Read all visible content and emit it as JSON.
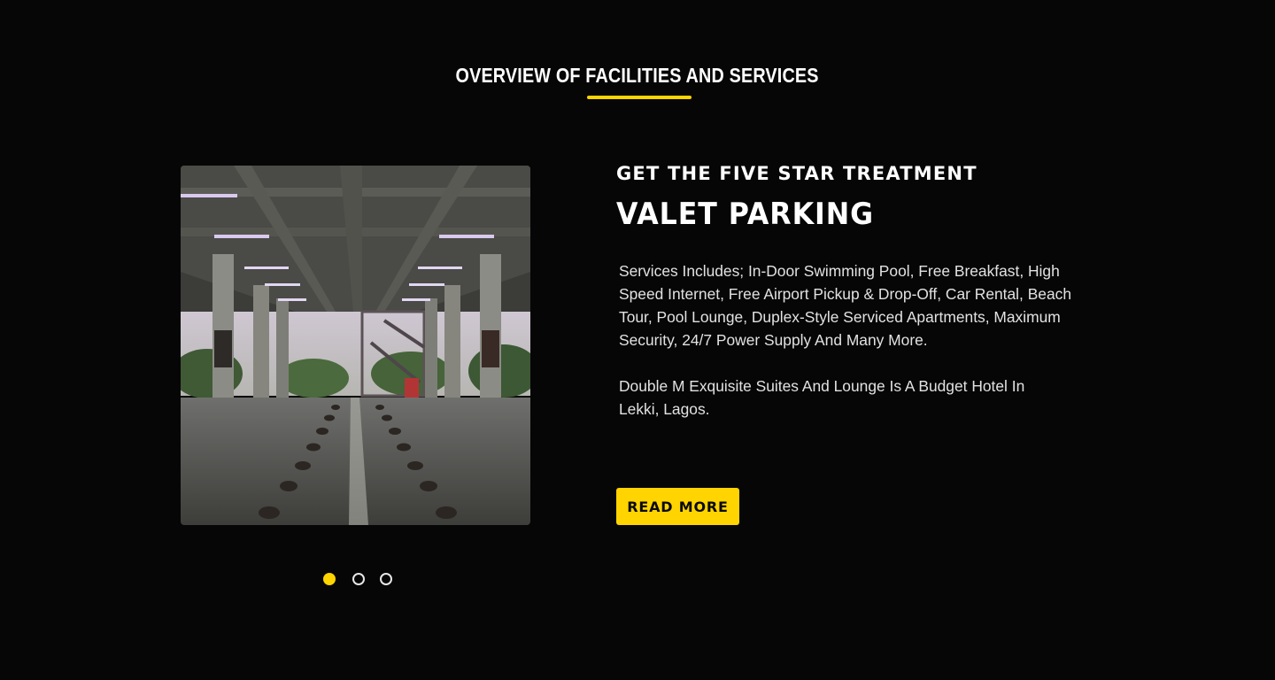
{
  "section": {
    "title": "OVERVIEW OF FACILITIES AND SERVICES"
  },
  "colors": {
    "accent": "#ffd400",
    "background": "#070607",
    "text": "#ffffff"
  },
  "slide": {
    "image_icon": "parking-garage-photo",
    "kicker": "GET THE FIVE STAR TREATMENT",
    "heading": "VALET PARKING",
    "paragraph_1": "Services Includes; In-Door Swimming Pool, Free Breakfast, High Speed Internet, Free Airport Pickup & Drop-Off, Car Rental, Beach Tour, Pool Lounge, Duplex-Style Serviced Apartments, Maximum Security, 24/7 Power Supply And Many More.",
    "paragraph_2": "Double M Exquisite Suites And Lounge Is A Budget Hotel In Lekki, Lagos.",
    "button_label": "READ MORE"
  },
  "carousel": {
    "total_slides": 3,
    "active_index": 0
  }
}
